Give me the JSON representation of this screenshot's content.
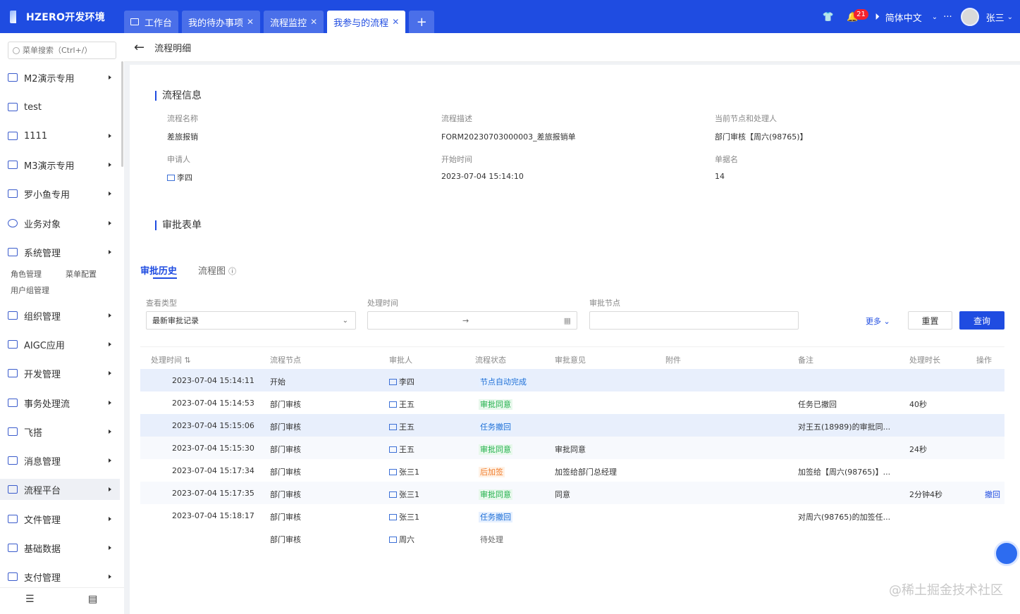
{
  "app": {
    "title": "HZERO开发环境"
  },
  "tabs": [
    {
      "label": "工作台"
    },
    {
      "label": "我的待办事项"
    },
    {
      "label": "流程监控"
    },
    {
      "label": "我参与的流程"
    }
  ],
  "topbar": {
    "notify_count": "21",
    "language": "简体中文",
    "user": "张三"
  },
  "sidebar": {
    "search_placeholder": "菜单搜索（Ctrl+/）",
    "items": [
      {
        "label": "M2演示专用"
      },
      {
        "label": "test"
      },
      {
        "label": "1111"
      },
      {
        "label": "M3演示专用"
      },
      {
        "label": "罗小鱼专用"
      },
      {
        "label": "业务对象"
      },
      {
        "label": "系统管理"
      },
      {
        "label": "组织管理"
      },
      {
        "label": "AIGC应用"
      },
      {
        "label": "开发管理"
      },
      {
        "label": "事务处理流"
      },
      {
        "label": "飞搭"
      },
      {
        "label": "消息管理"
      },
      {
        "label": "流程平台"
      },
      {
        "label": "文件管理"
      },
      {
        "label": "基础数据"
      },
      {
        "label": "支付管理"
      }
    ],
    "sub_links": [
      "角色管理",
      "菜单配置",
      "用户组管理"
    ]
  },
  "header": {
    "title": "流程明细"
  },
  "info": {
    "title": "流程信息",
    "name_label": "流程名称",
    "name": "差旅报销",
    "desc_label": "流程描述",
    "desc": "FORM20230703000003_差旅报销单",
    "node_label": "当前节点和处理人",
    "node": "部门审核【周六(98765)】",
    "applicant_label": "申请人",
    "applicant": "李四",
    "start_label": "开始时间",
    "start": "2023-07-04 15:14:10",
    "doc_label": "单据名",
    "doc": "14"
  },
  "form": {
    "title": "审批表单"
  },
  "subtabs": {
    "history": "审批历史",
    "diagram": "流程图"
  },
  "filters": {
    "type_label": "查看类型",
    "type_value": "最新审批记录",
    "time_label": "处理时间",
    "time_sep": "→",
    "node_label": "审批节点",
    "more": "更多",
    "reset": "重置",
    "query": "查询"
  },
  "table": {
    "headers": [
      "处理时间",
      "流程节点",
      "审批人",
      "流程状态",
      "审批意见",
      "附件",
      "备注",
      "处理时长",
      "操作"
    ],
    "rows": [
      {
        "time": "2023-07-04 15:14:11",
        "node": "开始",
        "user": "李四",
        "status": "节点自动完成",
        "status_color": "blue",
        "opinion": "",
        "note": "",
        "dur": "",
        "op": ""
      },
      {
        "time": "2023-07-04 15:14:53",
        "node": "部门审核",
        "user": "王五",
        "status": "审批同意",
        "status_color": "green",
        "opinion": "",
        "note": "任务已撤回",
        "dur": "40秒",
        "op": ""
      },
      {
        "time": "2023-07-04 15:15:06",
        "node": "部门审核",
        "user": "王五",
        "status": "任务撤回",
        "status_color": "blue",
        "opinion": "",
        "note": "对王五(18989)的审批同...",
        "dur": "",
        "op": ""
      },
      {
        "time": "2023-07-04 15:15:30",
        "node": "部门审核",
        "user": "王五",
        "status": "审批同意",
        "status_color": "green",
        "opinion": "审批同意",
        "note": "",
        "dur": "24秒",
        "op": ""
      },
      {
        "time": "2023-07-04 15:17:34",
        "node": "部门审核",
        "user": "张三1",
        "status": "后加签",
        "status_color": "orange",
        "opinion": "加签给部门总经理",
        "note": "加签给【周六(98765)】...",
        "dur": "",
        "op": ""
      },
      {
        "time": "2023-07-04 15:17:35",
        "node": "部门审核",
        "user": "张三1",
        "status": "审批同意",
        "status_color": "green",
        "opinion": "同意",
        "note": "",
        "dur": "2分钟4秒",
        "op": "撤回"
      },
      {
        "time": "2023-07-04 15:18:17",
        "node": "部门审核",
        "user": "张三1",
        "status": "任务撤回",
        "status_color": "blue",
        "opinion": "",
        "note": "对周六(98765)的加签任...",
        "dur": "",
        "op": ""
      },
      {
        "time": "",
        "node": "部门审核",
        "user": "周六",
        "status": "待处理",
        "status_color": "gray",
        "opinion": "",
        "note": "",
        "dur": "",
        "op": ""
      }
    ]
  },
  "watermark": "@稀土掘金技术社区"
}
